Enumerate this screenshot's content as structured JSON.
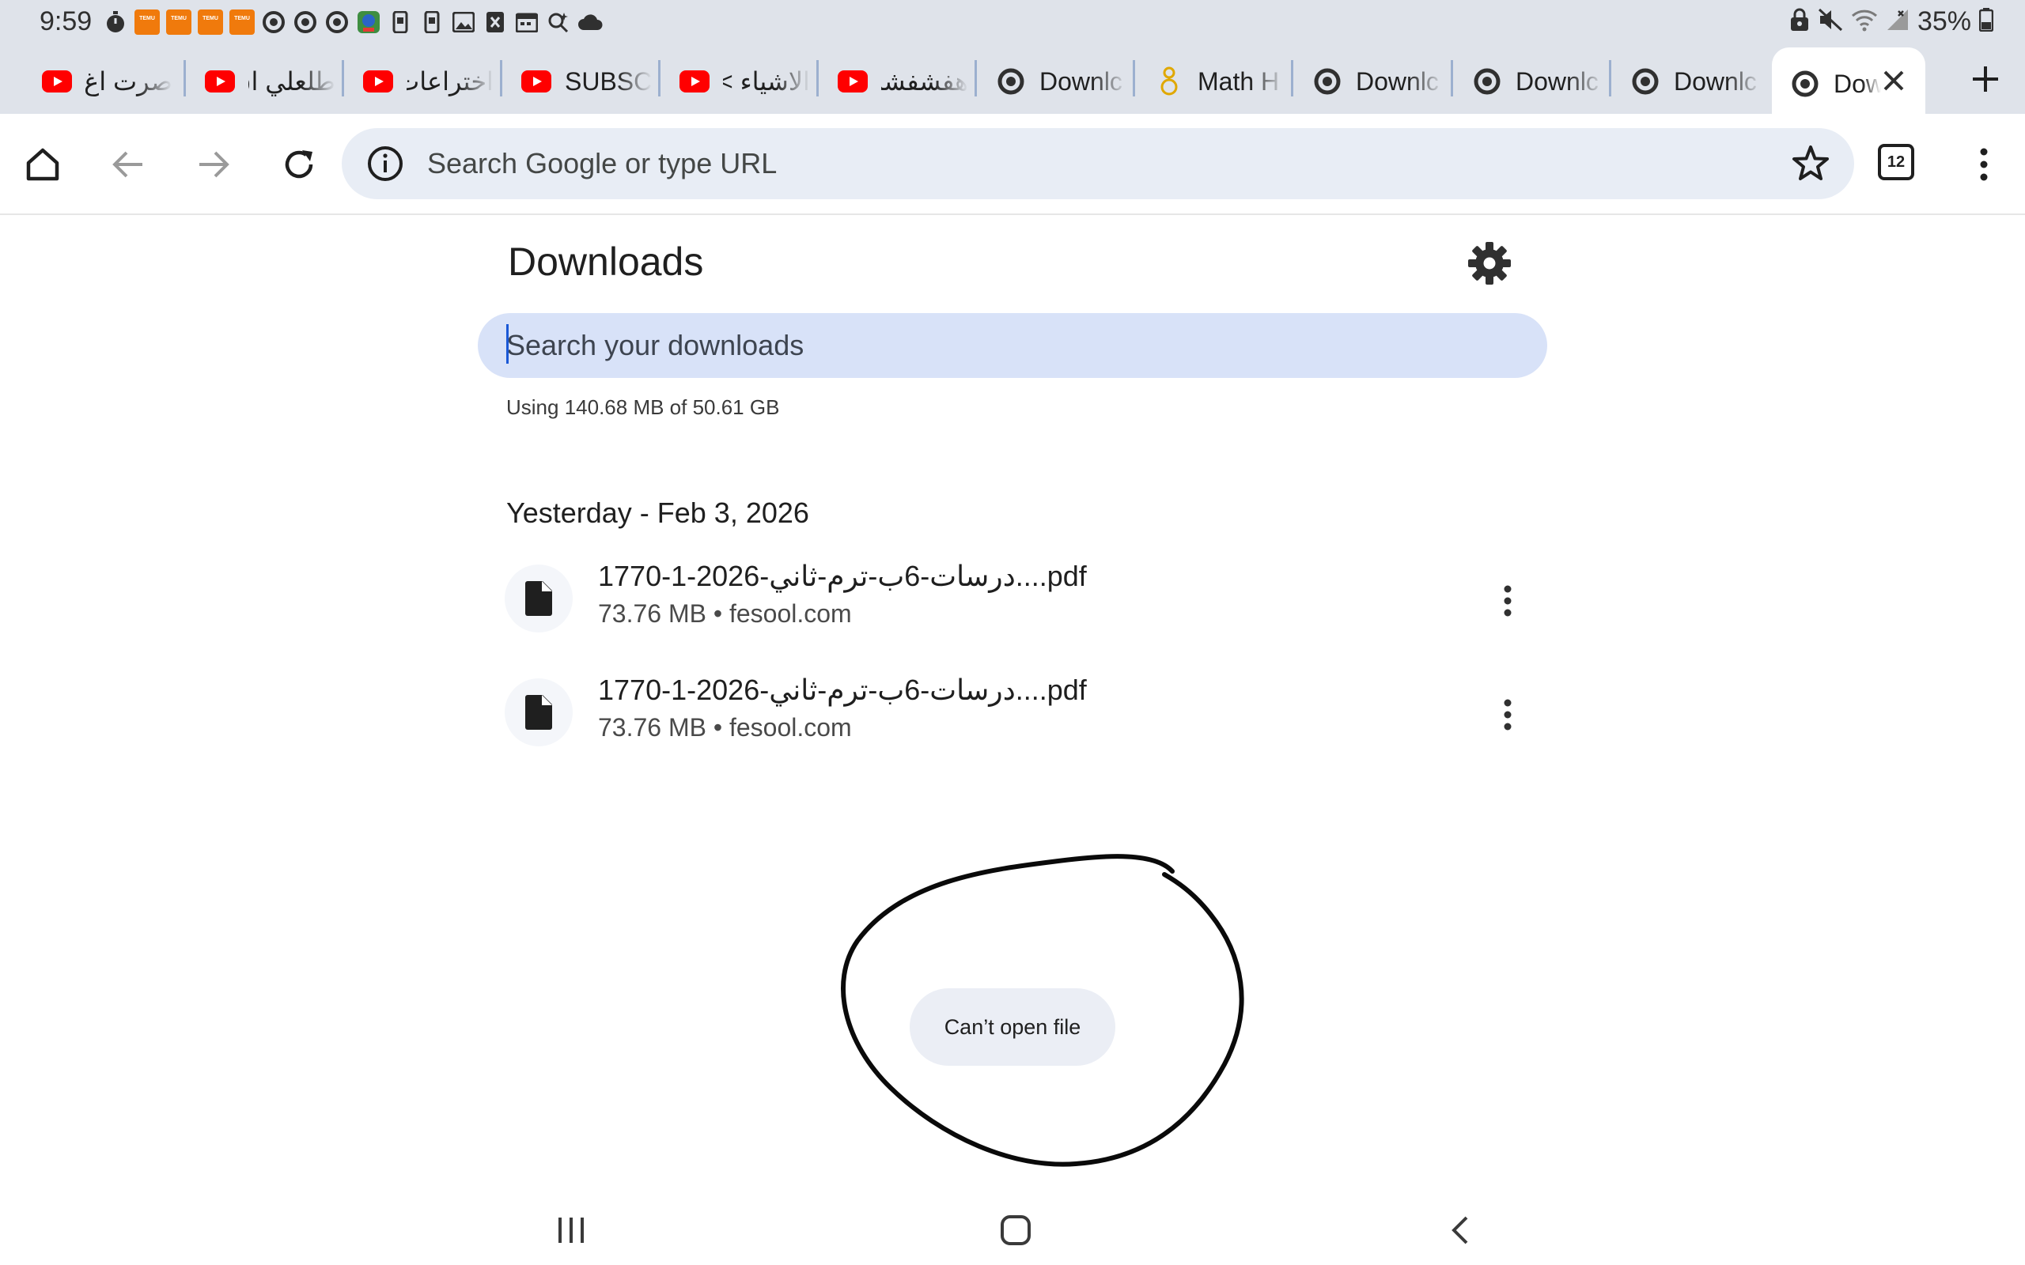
{
  "status_bar": {
    "time": "9:59",
    "battery": "35%",
    "temu_label": "TEMU",
    "notification_icons": [
      "timer-icon",
      "temu-icon",
      "temu-icon",
      "temu-icon",
      "temu-icon",
      "chrome-icon",
      "chrome-icon",
      "chrome-icon",
      "app-icon",
      "phone-icon",
      "phone-icon",
      "gallery-icon",
      "x-icon",
      "calendar-icon",
      "search-icon",
      "cloud-icon"
    ],
    "system_icons": [
      "lock-icon",
      "mute-icon",
      "wifi-icon",
      "signal-icon",
      "battery-icon"
    ]
  },
  "tabs": [
    {
      "label": "صرت اغ",
      "favicon": "youtube-icon"
    },
    {
      "label": "طلعلي اق",
      "favicon": "youtube-icon"
    },
    {
      "label": "اختراعات",
      "favicon": "youtube-icon"
    },
    {
      "label": "SUBSC",
      "favicon": "youtube-icon"
    },
    {
      "label": "الاشياء >",
      "favicon": "youtube-icon"
    },
    {
      "label": "هفشفشك",
      "favicon": "youtube-icon"
    },
    {
      "label": "Downlc",
      "favicon": "chrome-icon"
    },
    {
      "label": "Math H",
      "favicon": "math-icon"
    },
    {
      "label": "Downlc",
      "favicon": "chrome-icon"
    },
    {
      "label": "Downlc",
      "favicon": "chrome-icon"
    },
    {
      "label": "Downlc",
      "favicon": "chrome-icon"
    },
    {
      "label": "Dow",
      "favicon": "chrome-icon",
      "active": true
    }
  ],
  "toolbar": {
    "omnibox_placeholder": "Search Google or type URL",
    "tab_count": "12"
  },
  "page": {
    "title": "Downloads",
    "search_placeholder": "Search your downloads",
    "storage": "Using 140.68 MB of 50.61 GB",
    "date_header": "Yesterday - Feb 3, 2026",
    "downloads": [
      {
        "name": "درسات-6ب-ترم-ثاني-2026-1-1770....pdf",
        "size": "73.76 MB",
        "separator": "•",
        "source": "fesool.com"
      },
      {
        "name": "درسات-6ب-ترم-ثاني-2026-1-1770....pdf",
        "size": "73.76 MB",
        "separator": "•",
        "source": "fesool.com"
      }
    ]
  },
  "toast": {
    "message": "Can’t open file"
  },
  "colors": {
    "accent": "#1a58d6",
    "youtube": "#ff0000",
    "temu": "#f07a0c",
    "search_bg": "#d8e2f8",
    "chrome_bg": "#dfe3ea"
  }
}
